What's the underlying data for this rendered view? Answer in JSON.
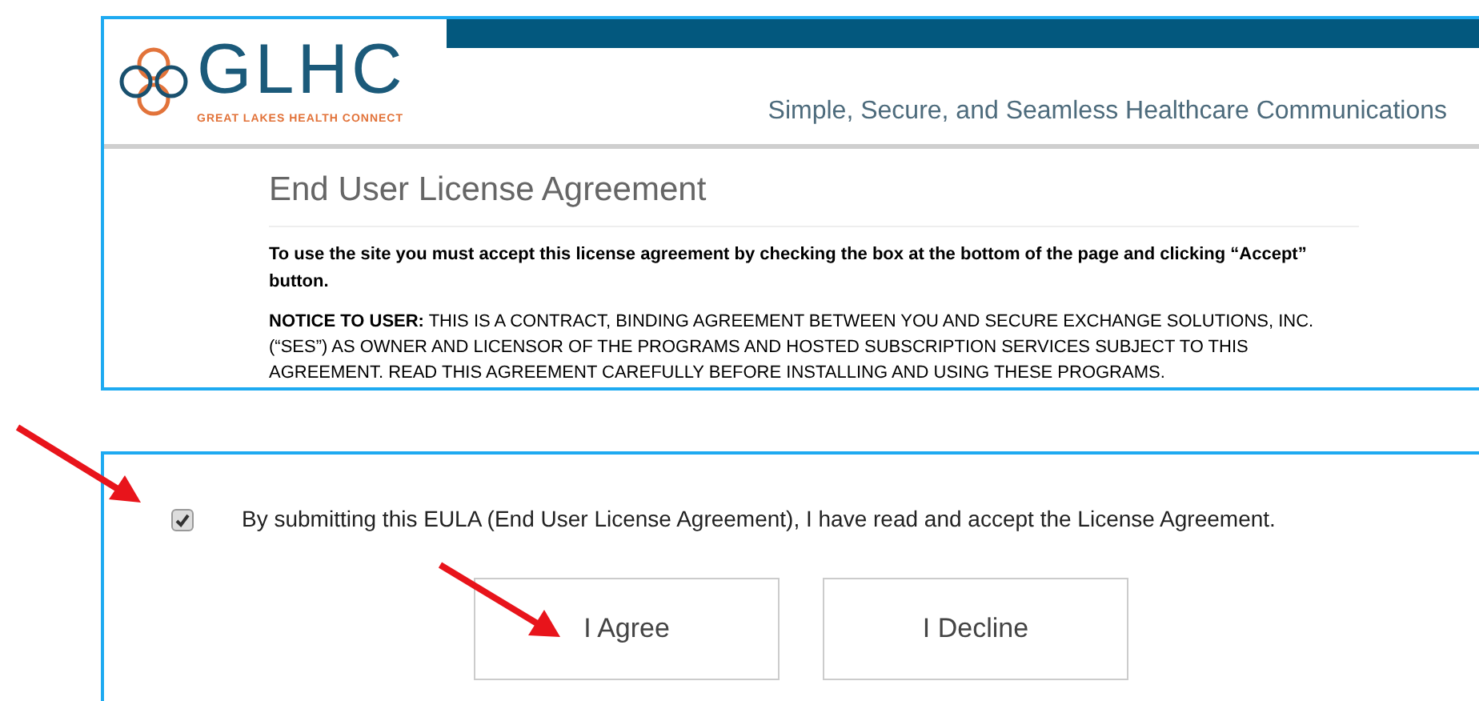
{
  "header": {
    "logo_text": "GLHC",
    "logo_subtitle": "GREAT LAKES HEALTH CONNECT",
    "tagline": "Simple, Secure, and Seamless Healthcare Communications"
  },
  "agreement": {
    "title": "End User License Agreement",
    "intro": "To use the site you must accept this license agreement by checking the box at the bottom of the page and clicking “Accept” button.",
    "notice": "**NOTICE TO USER:** THIS IS A CONTRACT, BINDING AGREEMENT BETWEEN YOU AND SECURE EXCHANGE SOLUTIONS, INC. (“SES”) AS OWNER AND LICENSOR OF THE PROGRAMS AND HOSTED SUBSCRIPTION SERVICES SUBJECT TO THIS AGREEMENT. READ THIS AGREEMENT CAREFULLY BEFORE INSTALLING AND USING THESE PROGRAMS."
  },
  "acceptance": {
    "checked": true,
    "label": "By submitting this EULA (End User License Agreement), I have read and accept the License Agreement.",
    "buttons": [
      "I Agree",
      "I Decline"
    ]
  }
}
